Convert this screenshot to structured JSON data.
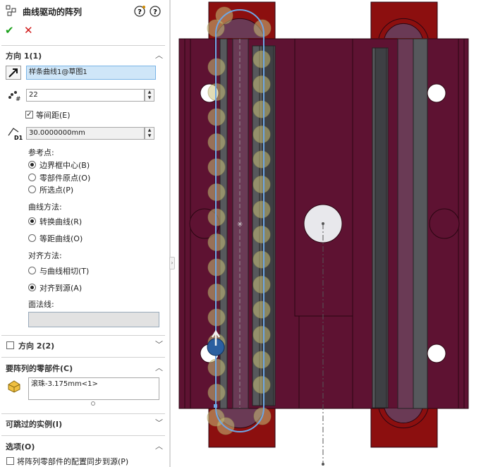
{
  "header": {
    "title": "曲线驱动的阵列",
    "ok_symbol": "✔",
    "cancel_symbol": "✕"
  },
  "direction1": {
    "title": "方向 1(1)",
    "curve_value": "样条曲线1@草图1",
    "count_value": "22",
    "equal_spacing_label": "等间距(E)",
    "spacing_value": "30.0000000mm",
    "reference_point_label": "参考点:",
    "ref_options": [
      "边界框中心(B)",
      "零部件原点(O)",
      "所选点(P)"
    ],
    "curve_method_label": "曲线方法:",
    "curve_method_options": [
      "转换曲线(R)",
      "等距曲线(O)"
    ],
    "align_method_label": "对齐方法:",
    "align_options": [
      "与曲线相切(T)",
      "对齐到源(A)"
    ],
    "face_normal_label": "面法线:"
  },
  "direction2": {
    "title": "方向 2(2)"
  },
  "components": {
    "title": "要阵列的零部件(C)",
    "item": "滚珠-3.175mm<1>"
  },
  "skip": {
    "title": "可跳过的实例(I)"
  },
  "options": {
    "title": "选项(O)",
    "sync_label": "将阵列零部件的配置同步到源(P)"
  },
  "colors": {
    "part_body": "#5e1232",
    "part_dark": "#4a0c24",
    "curve": "#6ea7e6",
    "ball": "#c9c07a",
    "red": "#8c0f0f",
    "rail": "#56585c"
  },
  "icons": [
    "pushpin-icon",
    "help-icon",
    "ok-check-icon",
    "cancel-x-icon",
    "curve-select-icon",
    "instances-icon",
    "spacing-icon",
    "component-icon"
  ]
}
